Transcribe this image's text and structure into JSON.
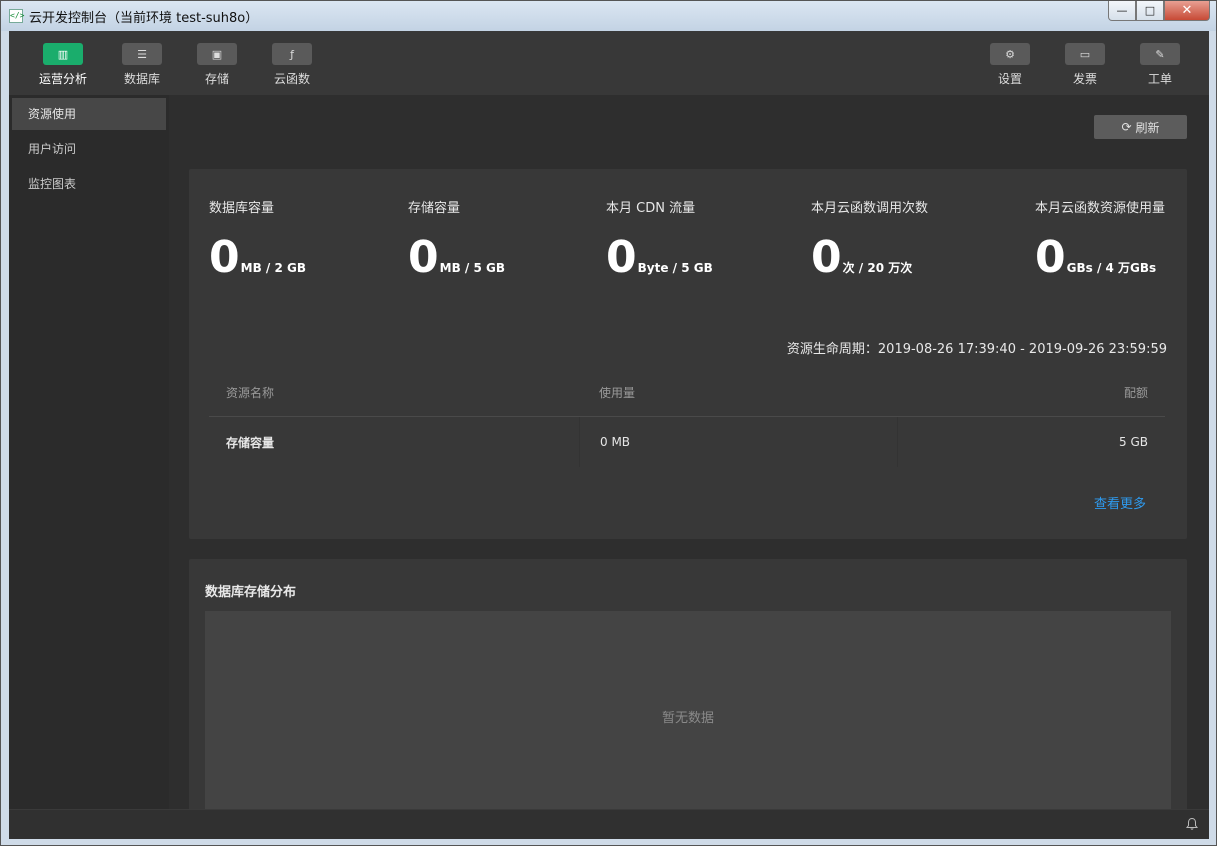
{
  "window": {
    "icon": "</>",
    "title": "云开发控制台（当前环境 test-suh8o）",
    "minimize": "—",
    "maximize": "□",
    "close": "✕"
  },
  "topnav": {
    "left": [
      {
        "label": "运营分析",
        "icon": "bar-chart-icon",
        "glyph": "▥",
        "active": true
      },
      {
        "label": "数据库",
        "icon": "database-icon",
        "glyph": "☰",
        "active": false
      },
      {
        "label": "存储",
        "icon": "floppy-icon",
        "glyph": "▣",
        "active": false
      },
      {
        "label": "云函数",
        "icon": "function-icon",
        "glyph": "ƒ",
        "active": false
      }
    ],
    "right": [
      {
        "label": "设置",
        "icon": "gear-icon",
        "glyph": "⚙"
      },
      {
        "label": "发票",
        "icon": "invoice-icon",
        "glyph": "▭"
      },
      {
        "label": "工单",
        "icon": "ticket-icon",
        "glyph": "✎"
      }
    ]
  },
  "sidebar": {
    "items": [
      {
        "label": "资源使用",
        "active": true
      },
      {
        "label": "用户访问",
        "active": false
      },
      {
        "label": "监控图表",
        "active": false
      }
    ]
  },
  "toolbar": {
    "refresh_label": "刷新",
    "refresh_icon": "⟳"
  },
  "stats": [
    {
      "label": "数据库容量",
      "value": "0",
      "unit": "MB / 2 GB"
    },
    {
      "label": "存储容量",
      "value": "0",
      "unit": "MB / 5 GB"
    },
    {
      "label": "本月 CDN 流量",
      "value": "0",
      "unit": "Byte / 5 GB"
    },
    {
      "label": "本月云函数调用次数",
      "value": "0",
      "unit": "次 / 20 万次"
    },
    {
      "label": "本月云函数资源使用量",
      "value": "0",
      "unit": "GBs / 4 万GBs"
    }
  ],
  "lifecycle": "资源生命周期：2019-08-26 17:39:40 - 2019-09-26 23:59:59",
  "table": {
    "headers": [
      "资源名称",
      "使用量",
      "配额"
    ],
    "rows": [
      {
        "name": "存储容量",
        "usage": "0 MB",
        "quota": "5 GB"
      }
    ]
  },
  "more_link": "查看更多",
  "db_distribution": {
    "title": "数据库存储分布",
    "empty_text": "暂无数据"
  },
  "colors": {
    "accent": "#1aad6c",
    "link": "#2e9bf0"
  }
}
